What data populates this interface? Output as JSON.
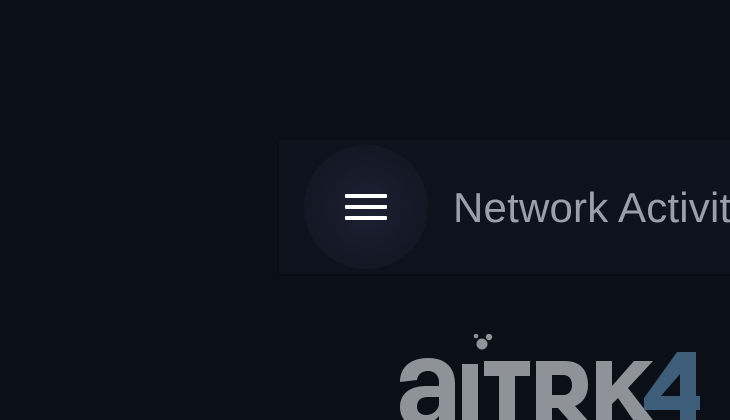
{
  "app_bar": {
    "title": "Network Activity",
    "menu_icon": "hamburger-menu-icon"
  },
  "logo": {
    "text": "aiTRK4",
    "colors": {
      "letters": "#8f9399",
      "digit": "#3d5d78"
    }
  },
  "colors": {
    "background": "#0b0f18",
    "app_bar": "#0e121d",
    "title_text": "#9aa0aa",
    "menu_icon": "#ffffff"
  }
}
